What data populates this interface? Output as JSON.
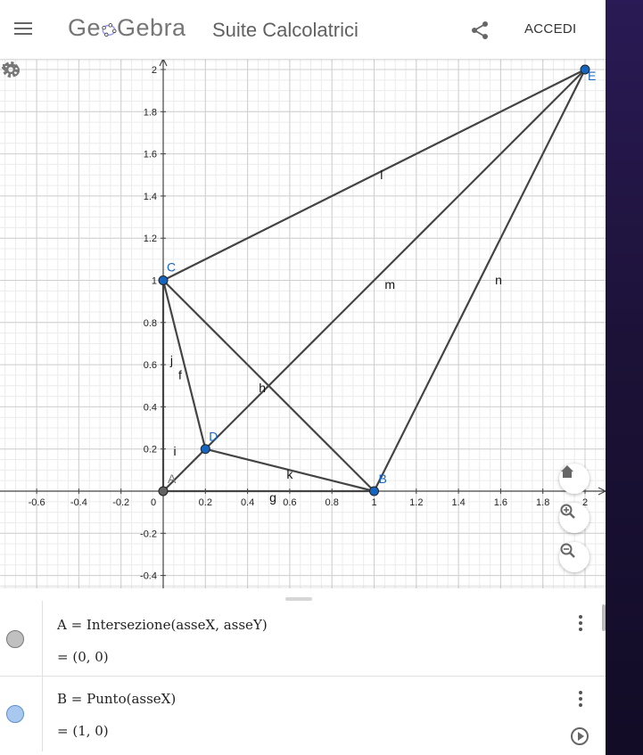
{
  "header": {
    "brand_left": "Ge",
    "brand_right": "Gebra",
    "title": "Suite Calcolatrici",
    "login_label": "ACCEDI",
    "icons": [
      "menu-icon",
      "share-icon"
    ]
  },
  "graphics": {
    "x_ticks": [
      "-0.6",
      "-0.4",
      "-0.2",
      "0",
      "0.2",
      "0.4",
      "0.6",
      "0.8",
      "1",
      "1.2",
      "1.4",
      "1.6",
      "1.8",
      "2"
    ],
    "y_ticks": [
      "-0.4",
      "-0.2",
      "0.2",
      "0.4",
      "0.6",
      "0.8",
      "1",
      "1.2",
      "1.4",
      "1.6",
      "1.8",
      "2"
    ],
    "points": [
      {
        "label": "A",
        "x": 0,
        "y": 0,
        "color": "#616161"
      },
      {
        "label": "B",
        "x": 1,
        "y": 0,
        "color": "#1565c0"
      },
      {
        "label": "C",
        "x": 0,
        "y": 1,
        "color": "#1565c0"
      },
      {
        "label": "D",
        "x": 0.2,
        "y": 0.2,
        "color": "#1565c0"
      },
      {
        "label": "E",
        "x": 2,
        "y": 2,
        "color": "#1565c0"
      }
    ],
    "segments": [
      {
        "label": "g",
        "from": "A",
        "to": "B",
        "lx": 0.52,
        "ly": -0.05
      },
      {
        "label": "j",
        "from": "A",
        "to": "C",
        "lx": 0.04,
        "ly": 0.6
      },
      {
        "label": "i",
        "from": "A",
        "to": "D",
        "lx": 0.055,
        "ly": 0.17
      },
      {
        "label": "f",
        "from": "C",
        "to": "D",
        "lx": 0.08,
        "ly": 0.53
      },
      {
        "label": "h",
        "from": "C",
        "to": "B",
        "lx": 0.47,
        "ly": 0.47
      },
      {
        "label": "k",
        "from": "D",
        "to": "B",
        "lx": 0.6,
        "ly": 0.06
      },
      {
        "label": "l",
        "from": "C",
        "to": "E",
        "lx": 1.035,
        "ly": 1.48
      },
      {
        "label": "m",
        "from": "D",
        "to": "E",
        "lx": 1.075,
        "ly": 0.96
      },
      {
        "label": "n",
        "from": "B",
        "to": "E",
        "lx": 1.59,
        "ly": 0.98
      }
    ],
    "controls": [
      "undo-icon",
      "settings-icon",
      "home-icon",
      "zoom-in-icon",
      "zoom-out-icon"
    ]
  },
  "algebra": {
    "rows": [
      {
        "definition": "A = Intersezione(asseX, asseY)",
        "value": "= (0, 0)",
        "marble_color": "#c0c0c0"
      },
      {
        "definition": "B = Punto(asseX)",
        "value": "= (1, 0)",
        "marble_color": "#a8c8f0"
      }
    ]
  }
}
